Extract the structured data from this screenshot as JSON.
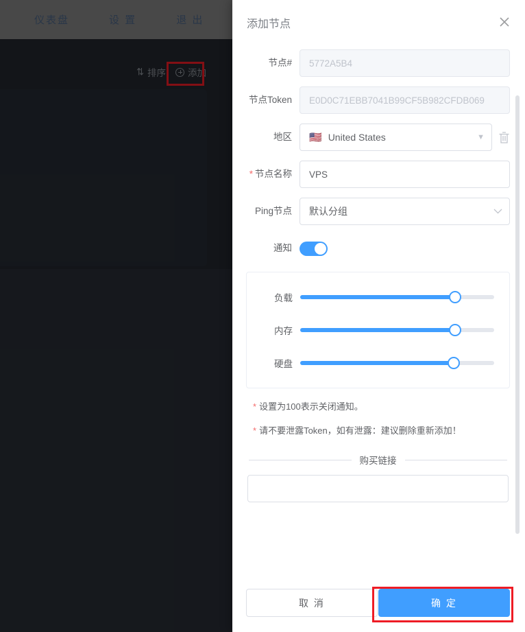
{
  "background": {
    "nav": {
      "items": [
        {
          "label": "仪表盘",
          "name": "nav-dashboard"
        },
        {
          "label": "设 置",
          "name": "nav-settings"
        },
        {
          "label": "退 出",
          "name": "nav-logout"
        }
      ]
    },
    "toolbar": {
      "sort_label": "排序",
      "sort_icon": "sort-icon",
      "add_label": "添加",
      "add_icon": "plus-circle-icon"
    }
  },
  "dialog": {
    "title": "添加节点",
    "close_icon": "close-icon",
    "fields": {
      "node_id": {
        "label": "节点#",
        "value": "",
        "placeholder": "5772A5B4",
        "disabled": true
      },
      "node_token": {
        "label": "节点Token",
        "value": "",
        "placeholder": "E0D0C71EBB7041B99CF5B982CFDB069",
        "disabled": true
      },
      "region": {
        "label": "地区",
        "selected": "United States",
        "flag": "🇺🇸",
        "caret_icon": "chevron-down-icon",
        "delete_icon": "trash-icon"
      },
      "node_name": {
        "label": "节点名称",
        "required": true,
        "required_mark": "*",
        "value": "VPS",
        "placeholder": ""
      },
      "ping_node": {
        "label": "Ping节点",
        "selected": "默认分组",
        "caret_icon": "chevron-down-icon"
      },
      "notify": {
        "label": "通知",
        "enabled": true
      },
      "purchase_link": {
        "divider_label": "购买链接",
        "value": "",
        "placeholder": ""
      }
    },
    "sliders": [
      {
        "label": "负载",
        "name": "slider-load",
        "percent": 80
      },
      {
        "label": "内存",
        "name": "slider-memory",
        "percent": 80
      },
      {
        "label": "硬盘",
        "name": "slider-disk",
        "percent": 79
      }
    ],
    "notes": [
      {
        "star": "*",
        "text": "设置为100表示关闭通知。"
      },
      {
        "star": "*",
        "text": "请不要泄露Token，如有泄露：建议删除重新添加！"
      }
    ],
    "footer": {
      "cancel_label": "取 消",
      "confirm_label": "确 定"
    }
  },
  "colors": {
    "accent": "#409eff",
    "highlight": "#ee1c25",
    "danger": "#f56c6c",
    "app_bg": "#23272e",
    "nav_bg": "#848484"
  }
}
